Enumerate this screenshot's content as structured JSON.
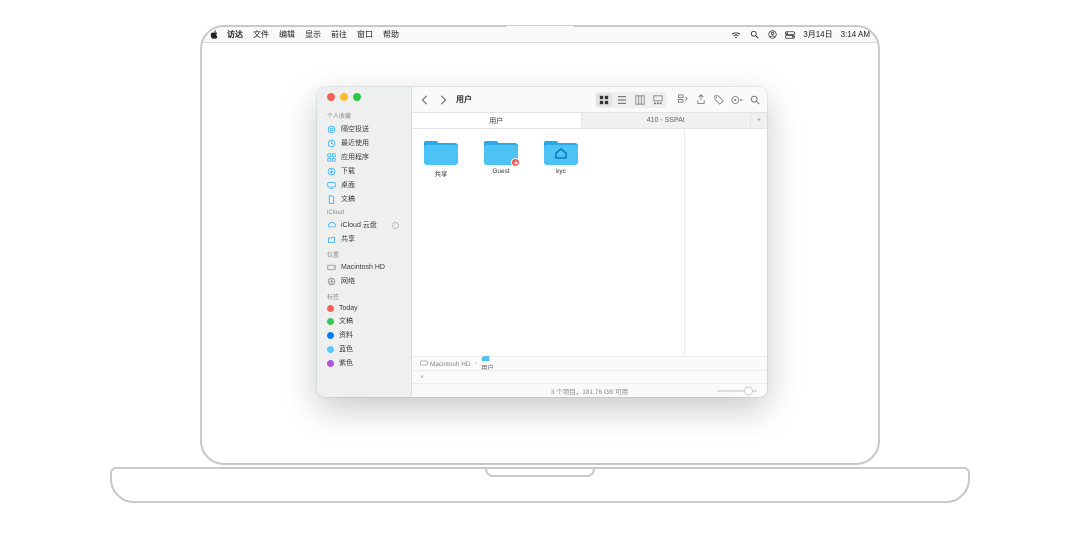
{
  "menubar": {
    "app": "访达",
    "items": [
      "文件",
      "编辑",
      "显示",
      "前往",
      "窗口",
      "帮助"
    ],
    "date": "3月14日",
    "time": "3:14 AM"
  },
  "finder": {
    "title": "用户",
    "tabs": [
      {
        "label": "用户",
        "active": true
      },
      {
        "label": "410 - SSPAI",
        "active": false
      }
    ],
    "sidebar": {
      "favorites_label": "个人收藏",
      "favorites": [
        {
          "name": "airdrop",
          "label": "隔空投送",
          "icon": "airdrop-icon"
        },
        {
          "name": "recents",
          "label": "最近使用",
          "icon": "clock-icon"
        },
        {
          "name": "apps",
          "label": "应用程序",
          "icon": "apps-icon"
        },
        {
          "name": "downloads",
          "label": "下载",
          "icon": "download-icon"
        },
        {
          "name": "desktop",
          "label": "桌面",
          "icon": "desktop-icon"
        },
        {
          "name": "documents",
          "label": "文稿",
          "icon": "document-icon"
        }
      ],
      "icloud_label": "iCloud",
      "icloud": [
        {
          "name": "icloud-drive",
          "label": "iCloud 云盘",
          "icon": "cloud-icon",
          "syncing": true
        },
        {
          "name": "shared",
          "label": "共享",
          "icon": "shared-icon"
        }
      ],
      "locations_label": "位置",
      "locations": [
        {
          "name": "macintosh-hd",
          "label": "Macintosh HD",
          "icon": "disk-icon"
        },
        {
          "name": "network",
          "label": "网络",
          "icon": "globe-icon"
        }
      ],
      "tags_label": "标签",
      "tags": [
        {
          "name": "today",
          "label": "Today",
          "color": "#ff5f57"
        },
        {
          "name": "wengao",
          "label": "文稿",
          "color": "#34c759"
        },
        {
          "name": "ziliao",
          "label": "资料",
          "color": "#007aff"
        },
        {
          "name": "lanse",
          "label": "蓝色",
          "color": "#5ac8fa"
        },
        {
          "name": "zise",
          "label": "紫色",
          "color": "#af52de"
        }
      ]
    },
    "files": [
      {
        "name": "shared-folder",
        "label": "共享",
        "type": "folder"
      },
      {
        "name": "guest-folder",
        "label": "Guest",
        "type": "folder",
        "badge": "no-entry"
      },
      {
        "name": "kyc-folder",
        "label": "kyc",
        "type": "folder",
        "home": true
      }
    ],
    "path": [
      {
        "label": "Macintosh HD",
        "kind": "disk"
      },
      {
        "label": "用户",
        "kind": "folder"
      }
    ],
    "status": "3 个项目，181.76 GB 可用"
  }
}
